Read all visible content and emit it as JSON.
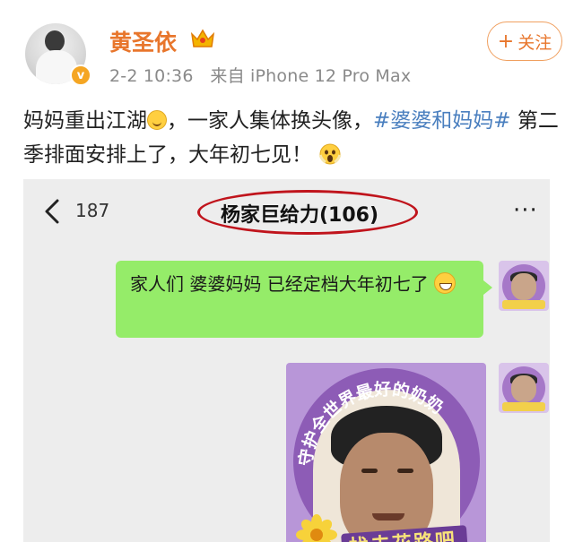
{
  "post": {
    "username": "黄圣依",
    "time": "2-2 10:36",
    "source": "来自 iPhone 12 Pro Max",
    "follow_label": "关注",
    "follow_plus": "+",
    "verify_mark": "v",
    "text_part1": "妈妈重出江湖",
    "text_part2": "，一家人集体换头像，",
    "hashtag": "#婆婆和妈妈#",
    "text_part3": " 第二季排面安排上了，大年初七见！"
  },
  "chat": {
    "back_count": "187",
    "group_title": "杨家巨给力(106)",
    "more": "···",
    "message_text": "家人们  婆婆妈妈 已经定档大年初七了",
    "sticker_arc_text": "守护全世界最好的奶奶",
    "sticker_banner_text": "找夫花路吧"
  },
  "colors": {
    "username": "#e8762c",
    "hashtag": "#4a7fbf",
    "bubble": "#95ec69",
    "highlight_ellipse": "#c0141c",
    "sticker_purple": "#8d5cb6"
  },
  "icons": {
    "crown": "crown-icon",
    "verify": "verified-badge-icon",
    "back": "chevron-left-icon",
    "more": "more-dots-icon"
  }
}
